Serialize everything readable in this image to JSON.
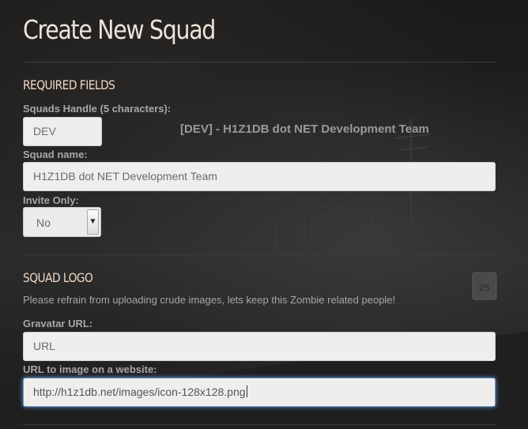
{
  "page": {
    "title": "Create New Squad"
  },
  "required": {
    "heading": "REQUIRED FIELDS",
    "handle_label": "Squads Handle (5 characters):",
    "handle_value": "DEV",
    "handle_preview": "[DEV] - H1Z1DB dot NET Development Team",
    "name_label": "Squad name:",
    "name_value": "H1Z1DB dot NET Development Team",
    "invite_label": "Invite Only:",
    "invite_value": "No"
  },
  "logo": {
    "heading": "SQUAD LOGO",
    "help_text": "Please refrain from uploading crude images, lets keep this Zombie related people!",
    "gravatar_label": "Gravatar URL:",
    "gravatar_placeholder": "URL",
    "image_url_label": "URL to image on a website:",
    "image_url_value": "http://h1z1db.net/images/icon-128x128.png"
  },
  "background": {
    "sign_number": "25"
  },
  "colors": {
    "title": "#ece3d8",
    "heading": "#f0d8c6",
    "focus": "#66a0e6"
  }
}
